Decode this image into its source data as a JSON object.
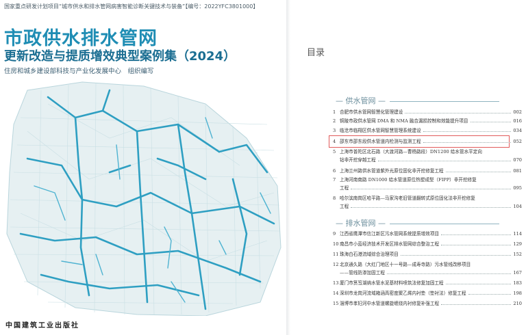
{
  "cover": {
    "project_line": "国家重点研发计划项目“城市供水和排水管网病害智能诊断关键技术与装备”【编号：2022YFC3801000】",
    "title_line1": "市政供水排水管网",
    "title_line2": "更新改造与提质增效典型案例集（",
    "title_year": "2024",
    "title_close": "）",
    "org_line": "住房和城乡建设部科技与产业化发展中心　组织编写",
    "publisher": "中国建筑工业出版社",
    "colors": {
      "title": "#1f8db4",
      "pipes": "#2e9fc2",
      "streets": "#c9dfe4"
    }
  },
  "toc": {
    "heading": "目录",
    "sections": [
      {
        "label": "供水管网",
        "items": [
          {
            "num": "1",
            "lines": [
              "合肥市供水管网智慧化管理建设"
            ],
            "page": "002"
          },
          {
            "num": "2",
            "lines": [
              "铜陵市政供水管网 DMA 和 NMA 融合漏损控制和效能提升项目"
            ],
            "page": "016"
          },
          {
            "num": "3",
            "lines": [
              "临沧市临翔区供水管网智慧管理系统建设"
            ],
            "page": "034"
          },
          {
            "num": "4",
            "lines": [
              "邵东市邵东段供水管道内检测与监测工程"
            ],
            "page": "052"
          },
          {
            "num": "5",
            "lines": [
              "上海市普陀区北石路（大渡河路—曹杨路段）DN1200 给水管水平定向",
              "钻非开挖穿越工程"
            ],
            "page": "070"
          },
          {
            "num": "6",
            "lines": [
              "上海兰州路供水管道紫外光原位固化非开挖修复工程"
            ],
            "page": "081"
          },
          {
            "num": "7",
            "lines": [
              "上海河南南路 DN1000 给水管道原位热塑成型（FIPP）非开挖修复",
              "工程"
            ],
            "page": "095"
          },
          {
            "num": "8",
            "lines": [
              "哈尔滨南岗区哈平路—马家沟老旧管道翻转式原位固化法非开挖修复",
              "工程"
            ],
            "page": "104"
          }
        ]
      },
      {
        "label": "排水管网",
        "items": [
          {
            "num": "9",
            "lines": [
              "江西省鹰潭市信江新区污水管网系统提质增效项目"
            ],
            "page": "114"
          },
          {
            "num": "10",
            "lines": [
              "南昌市小蓝经济技术开发区排水管网综合整治工程"
            ],
            "page": "129"
          },
          {
            "num": "11",
            "lines": [
              "珠海白石港流域综合治理项目"
            ],
            "page": "152"
          },
          {
            "num": "12",
            "lines": [
              "北京通久路（大红门地区十一号路—成寿寺路）污水管线改移项目",
              "——管线防渗加固工程"
            ],
            "page": "167"
          },
          {
            "num": "13",
            "lines": [
              "厦门市筼筜湖纳水管水泥基材料喷筑法修复加固工程"
            ],
            "page": "183"
          },
          {
            "num": "14",
            "lines": [
              "深圳市龙岗河流域箱涵高密度聚乙烯内衬垫（垫衬法）修复工程"
            ],
            "page": "198"
          },
          {
            "num": "15",
            "lines": [
              "淄博市孝妇河中水管道螺旋缠绕内衬修复补强工程"
            ],
            "page": "210"
          }
        ]
      }
    ]
  }
}
